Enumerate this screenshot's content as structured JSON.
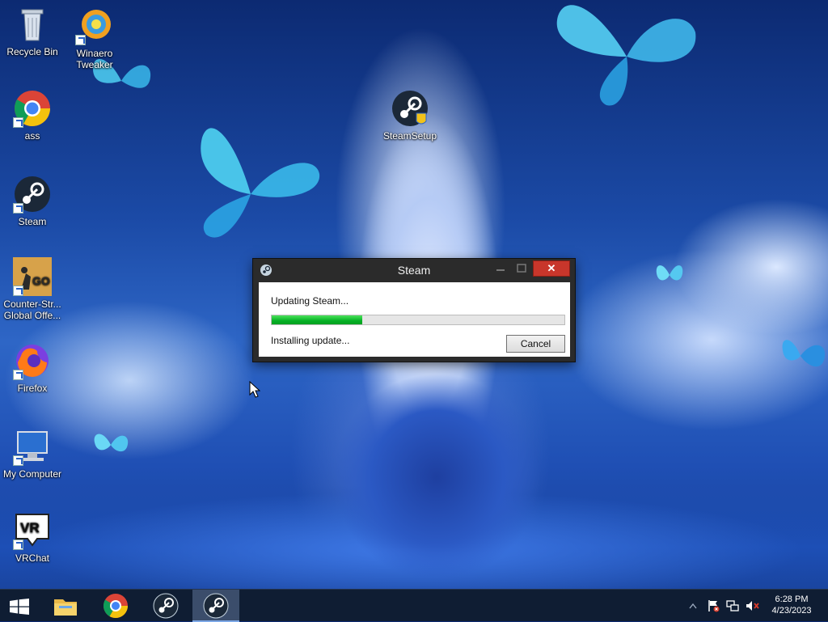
{
  "desktop": {
    "icons": [
      {
        "label": "Recycle Bin",
        "icon": "recycle-bin-icon"
      },
      {
        "label": "Winaero Tweaker",
        "icon": "winaero-tweaker-icon"
      },
      {
        "label": "ass",
        "icon": "chrome-icon"
      },
      {
        "label": "Steam",
        "icon": "steam-icon"
      },
      {
        "label": "Counter-Str... Global Offe...",
        "icon": "csgo-icon"
      },
      {
        "label": "Firefox",
        "icon": "firefox-icon"
      },
      {
        "label": "My Computer",
        "icon": "computer-icon"
      },
      {
        "label": "VRChat",
        "icon": "vrchat-icon"
      },
      {
        "label": "SteamSetup",
        "icon": "steam-setup-icon"
      }
    ]
  },
  "dialog": {
    "title": "Steam",
    "status": "Updating Steam...",
    "progress_percent": 31,
    "substatus": "Installing update...",
    "cancel_label": "Cancel",
    "close_glyph": "✕"
  },
  "taskbar": {
    "items": [
      {
        "icon": "windows-start-icon"
      },
      {
        "icon": "file-explorer-icon"
      },
      {
        "icon": "chrome-icon"
      },
      {
        "icon": "steam-icon"
      },
      {
        "icon": "steam-icon",
        "active": true
      }
    ],
    "tray": [
      "action-center-flag-icon",
      "network-icon",
      "volume-muted-icon"
    ],
    "time": "6:28 PM",
    "date": "4/23/2023"
  },
  "colors": {
    "close_button": "#c8362b",
    "progress_green": "#06b025",
    "taskbar": "#0f1d33"
  }
}
